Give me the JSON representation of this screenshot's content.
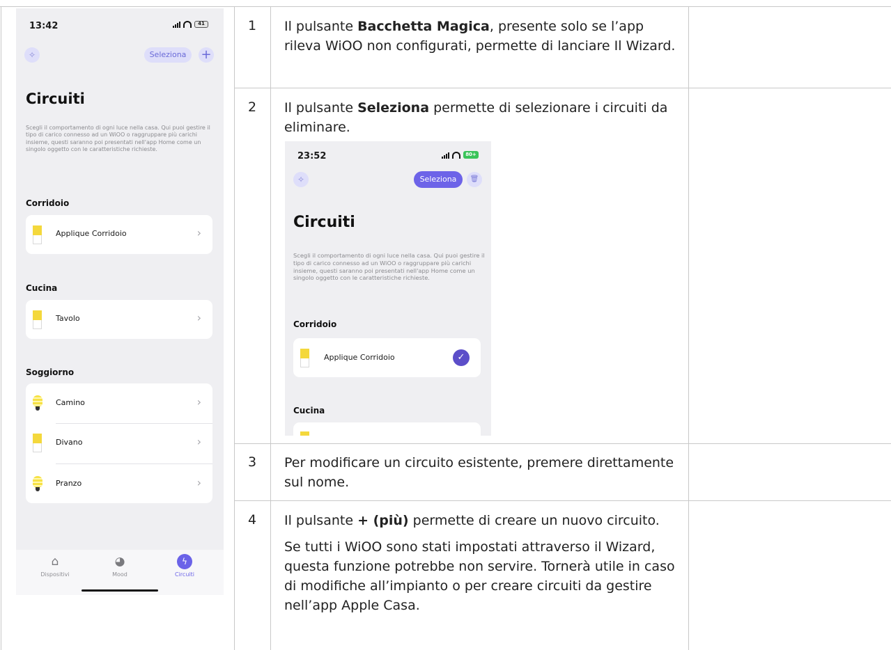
{
  "rows": [
    {
      "num": "1",
      "line1_pre": "Il pulsante ",
      "line1_bold": "Bacchetta Magica",
      "line1_post": ", presente solo se l’app rileva WiOO non configurati, permette di lanciare Il Wizard."
    },
    {
      "num": "2",
      "pre": "Il pulsante ",
      "bold": "Seleziona",
      "post": " permette di selezionare i circuiti da eliminare."
    },
    {
      "num": "3",
      "text": "Per modificare un circuito esistente, premere direttamente sul nome."
    },
    {
      "num": "4",
      "pre": "Il pulsante ",
      "bold": "+ (più)",
      "post": " permette di creare un nuovo circuito.",
      "para2": "Se tutti i WiOO sono stati impostati attraverso il Wizard, questa funzione potrebbe non servire. Tornerà utile in caso di modifiche all’impianto o per creare circuiti da gestire nell’app Apple Casa."
    }
  ],
  "phone": {
    "time": "13:42",
    "battery": "41",
    "select_label": "Seleziona",
    "plus_label": "+",
    "wand_icon": "✧",
    "title": "Circuiti",
    "description": "Scegli il comportamento di ogni luce nella casa. Qui puoi gestire il tipo di carico connesso ad un WiOO o raggruppare più carichi insieme, questi saranno poi presentati nell'app Home come un singolo oggetto con le caratteristiche richieste.",
    "sections": [
      {
        "name": "Corridoio",
        "items": [
          {
            "label": "Applique Corridoio",
            "icon": "panel-icon"
          }
        ]
      },
      {
        "name": "Cucina",
        "items": [
          {
            "label": "Tavolo",
            "icon": "panel-icon"
          }
        ]
      },
      {
        "name": "Soggiorno",
        "items": [
          {
            "label": "Camino",
            "icon": "bulb-icon"
          },
          {
            "label": "Divano",
            "icon": "panel-icon"
          },
          {
            "label": "Pranzo",
            "icon": "bulb-icon"
          }
        ]
      }
    ],
    "chevron": "›",
    "tabs": [
      {
        "label": "Dispositivi",
        "icon": "⌂"
      },
      {
        "label": "Mood",
        "icon": "◕"
      },
      {
        "label": "Circuiti",
        "icon": "ϟ"
      }
    ]
  },
  "phone2": {
    "time": "23:52",
    "battery": "80+",
    "select_label": "Seleziona",
    "trash_icon": "🗑",
    "wand_icon": "✧",
    "title": "Circuiti",
    "description": "Scegli il comportamento di ogni luce nella casa. Qui puoi gestire il tipo di carico connesso ad un WiOO o raggruppare più carichi insieme, questi saranno poi presentati nell'app Home come un singolo oggetto con le caratteristiche richieste.",
    "section1": "Corridoio",
    "item1": "Applique Corridoio",
    "check": "✓",
    "section2": "Cucina"
  },
  "colors": {
    "accent": "#6b63e8",
    "lamp_yellow": "#f4d83c",
    "grid": "#c8c8c8"
  }
}
